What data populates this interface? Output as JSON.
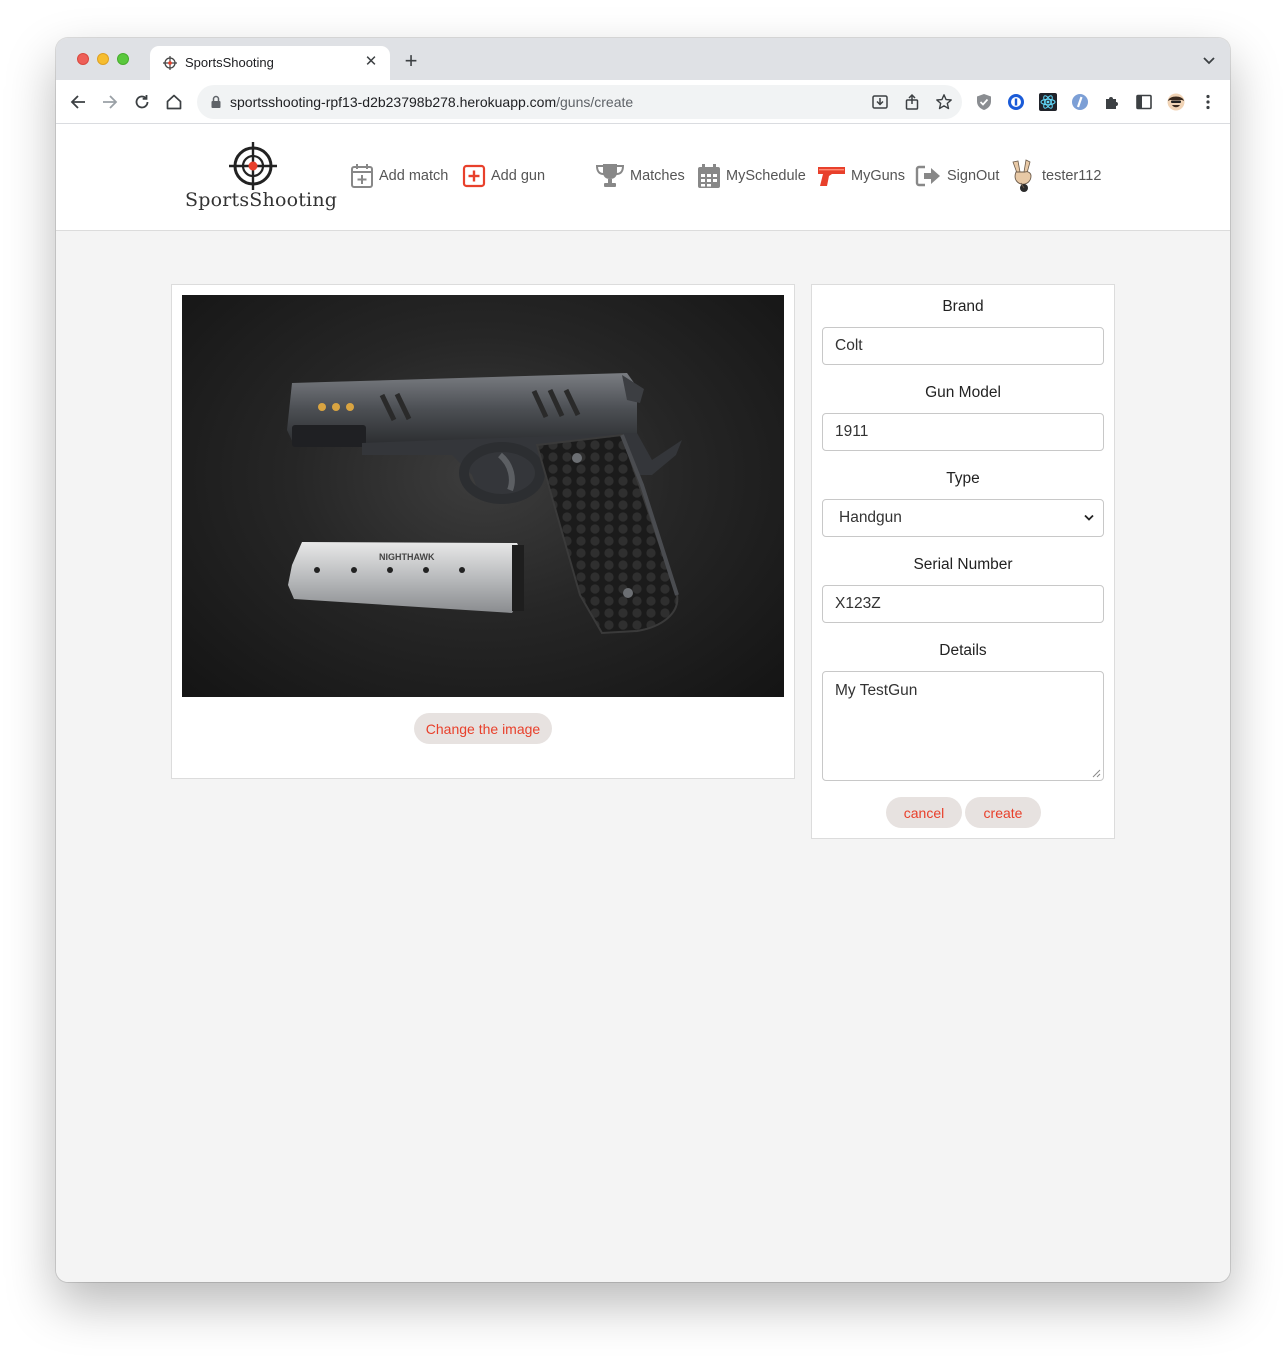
{
  "browser": {
    "tab_title": "SportsShooting",
    "url_domain": "sportsshooting-rpf13-d2b23798b278.herokuapp.com",
    "url_path": "/guns/create"
  },
  "site": {
    "logo_text": "SportsShooting",
    "nav": {
      "add_match": "Add match",
      "add_gun": "Add gun",
      "matches": "Matches",
      "my_schedule": "MySchedule",
      "my_guns": "MyGuns",
      "sign_out": "SignOut",
      "username": "tester112"
    }
  },
  "image_panel": {
    "change_button": "Change the image",
    "magazine_brand": "NIGHTHAWK"
  },
  "form": {
    "brand_label": "Brand",
    "brand_value": "Colt",
    "model_label": "Gun Model",
    "model_value": "1911",
    "type_label": "Type",
    "type_value": "Handgun",
    "serial_label": "Serial Number",
    "serial_value": "X123Z",
    "details_label": "Details",
    "details_value": "My TestGun",
    "cancel_button": "cancel",
    "create_button": "create"
  },
  "colors": {
    "accent_red": "#e8402b",
    "button_bg": "#e7e2e0",
    "page_bg": "#f4f4f4"
  }
}
